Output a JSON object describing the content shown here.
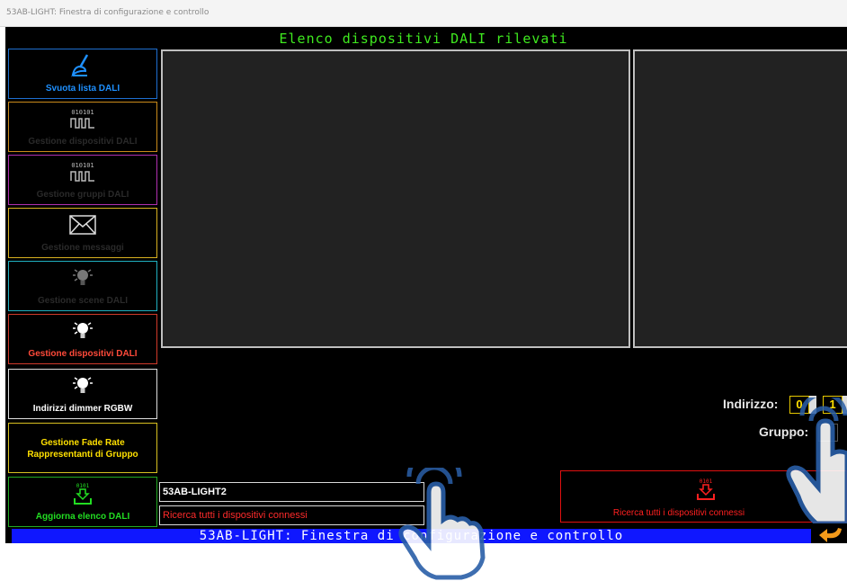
{
  "window": {
    "title": "53AB-LIGHT: Finestra di configurazione e controllo"
  },
  "header": {
    "title": "Elenco dispositivi DALI rilevati",
    "title_color": "#3fea1f"
  },
  "sidebar": {
    "items": [
      {
        "label": "Svuota lista DALI",
        "icon": "broom-icon",
        "color": "#1e90ff"
      },
      {
        "label": "Gestione dispositivi DALI",
        "icon": "binary-signal-icon",
        "color": "#c98a1a",
        "dimmed": true
      },
      {
        "label": "Gestione gruppi DALI",
        "icon": "binary-signal-icon",
        "color": "#c040c0",
        "dimmed": true
      },
      {
        "label": "Gestione messaggi",
        "icon": "envelope-icon",
        "color": "#d8b020",
        "dimmed": true
      },
      {
        "label": "Gestione scene DALI",
        "icon": "lightbulb-icon",
        "color": "#20c0d0",
        "dimmed": true
      },
      {
        "label": "Gestione dispositivi DALI",
        "icon": "lightbulb-icon",
        "color": "#ff4a3a"
      },
      {
        "label": "Indirizzi dimmer RGBW",
        "icon": "lightbulb-icon",
        "color": "#ffffff"
      },
      {
        "label_line1": "Gestione Fade Rate",
        "label_line2": "Rappresentanti di Gruppo",
        "color": "#ffe000"
      },
      {
        "label": "Aggiorna elenco DALI",
        "icon": "download-icon",
        "color": "#22dd22"
      }
    ]
  },
  "controls": {
    "address_label": "Indirizzo:",
    "address_value_1": "0",
    "address_value_2": "1",
    "group_label": "Gruppo:"
  },
  "inputs": {
    "device_name": "53AB-LIGHT2",
    "search_text": "Ricerca tutti i dispositivi connessi"
  },
  "search_button": {
    "label": "Ricerca tutti i dispositivi connessi",
    "icon": "download-icon",
    "color": "#ff2020"
  },
  "status_bar": {
    "text": "53AB-LIGHT: Finestra di configurazione e controllo",
    "background": "#0f17ff"
  }
}
